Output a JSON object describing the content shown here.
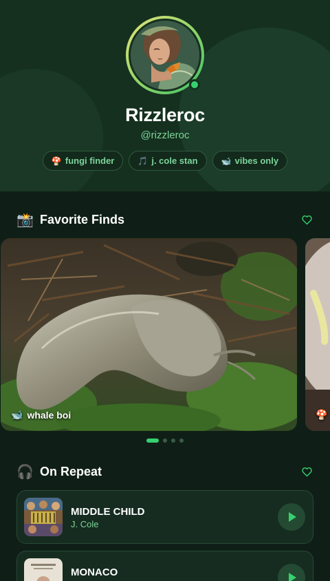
{
  "profile": {
    "name": "Rizzleroc",
    "handle": "@rizzleroc",
    "online": true,
    "tags": [
      {
        "emoji": "🍄",
        "label": "fungi finder"
      },
      {
        "emoji": "🎵",
        "label": "j. cole stan"
      },
      {
        "emoji": "🐋",
        "label": "vibes only"
      }
    ]
  },
  "favorites": {
    "emoji": "📸",
    "title": "Favorite Finds",
    "action_icon": "heart-outline-icon",
    "cards": [
      {
        "emoji": "🐋",
        "caption": "whale boi"
      },
      {
        "emoji": "🍄",
        "caption": ""
      }
    ],
    "pagination": {
      "count": 4,
      "active": 0
    }
  },
  "on_repeat": {
    "emoji": "🎧",
    "title": "On Repeat",
    "action_icon": "heart-outline-icon",
    "tracks": [
      {
        "title": "MIDDLE CHILD",
        "artist": "J. Cole"
      },
      {
        "title": "MONACO",
        "artist": ""
      }
    ]
  },
  "colors": {
    "background": "#0f1f17",
    "accent": "#36d06f",
    "accent_text": "#7dd49a",
    "card": "#162c20"
  }
}
